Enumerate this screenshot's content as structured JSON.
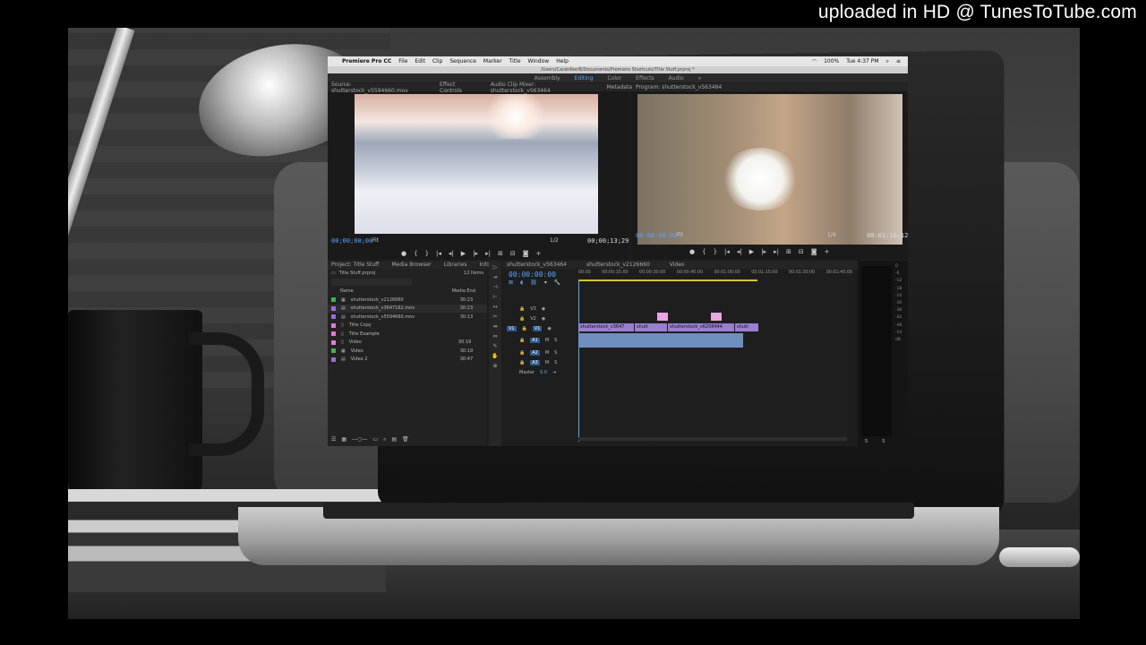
{
  "watermark": "uploaded in HD @ TunesToTube.com",
  "app": {
    "menu": [
      "Premiere Pro CC",
      "File",
      "Edit",
      "Clip",
      "Sequence",
      "Marker",
      "Title",
      "Window",
      "Help"
    ],
    "system_status": {
      "battery": "100%",
      "clock": "Tue 4:37 PM"
    },
    "path": "/Users/CaisbilberB/Documents/Premiere Shortcuts/Title Stuff.prproj *",
    "workspaces": [
      "Assembly",
      "Editing",
      "Color",
      "Effects",
      "Audio"
    ],
    "active_workspace": "Editing"
  },
  "source_panel": {
    "tabs": [
      "Source: shutterstock_v5594660.mov",
      "Effect Controls",
      "Audio Clip Mixer: shutterstock_v563464",
      "Metadata"
    ],
    "timecode_in": "00;00;00;00",
    "fit": "Fit",
    "scale": "1/2",
    "timecode_out": "00;00;13;29"
  },
  "program_panel": {
    "tab": "Program: shutterstock_v563464",
    "timecode_in": "00:00:00:00",
    "fit": "Fit",
    "scale": "1/4",
    "timecode_out": "00:01:16:12"
  },
  "project_panel": {
    "tabs": [
      "Project: Title Stuff",
      "Media Browser",
      "Libraries",
      "Info"
    ],
    "file": "Title Stuff.prproj",
    "count": "12 Items",
    "columns": [
      "Name",
      "Media End"
    ],
    "items": [
      {
        "name": "shutterstock_v2126660",
        "duration": "30:23",
        "color": "#3fb34f"
      },
      {
        "name": "shutterstock_v3647162.mov",
        "duration": "30:23",
        "color": "#9b6bd6"
      },
      {
        "name": "shutterstock_v5594660.mov",
        "duration": "30:13",
        "color": "#9b6bd6"
      },
      {
        "name": "Title Copy",
        "duration": "",
        "color": "#e27ad8"
      },
      {
        "name": "Title Example",
        "duration": "",
        "color": "#e27ad8"
      },
      {
        "name": "Video",
        "duration": "30:19",
        "color": "#e27ad8"
      },
      {
        "name": "Video",
        "duration": "30:19",
        "color": "#3fb34f"
      },
      {
        "name": "Video 2",
        "duration": "30:47",
        "color": "#9b6bd6"
      }
    ]
  },
  "timeline": {
    "tabs": [
      "shutterstock_v563464",
      "shutterstock_v2126660",
      "Video"
    ],
    "timecode": "00:00:00:00",
    "ruler": [
      "00:00",
      "00:00:15:00",
      "00:00:30:00",
      "00:00:45:00",
      "00:01:00:00",
      "00:01:15:00",
      "00:01:30:00",
      "00:01:45:00"
    ],
    "tracks": [
      "V3",
      "V2",
      "V1",
      "A1",
      "A2",
      "A3",
      "Master"
    ],
    "master_level": "0.0",
    "clips": [
      "shutterstock_v3647",
      "shutt",
      "shutterstock_v6208444",
      "shutt"
    ]
  },
  "meter": {
    "labels": [
      "0",
      "-6",
      "-12",
      "-18",
      "-24",
      "-30",
      "-36",
      "-42",
      "-48",
      "-54",
      "dB"
    ],
    "channels": [
      "S",
      "S"
    ]
  }
}
